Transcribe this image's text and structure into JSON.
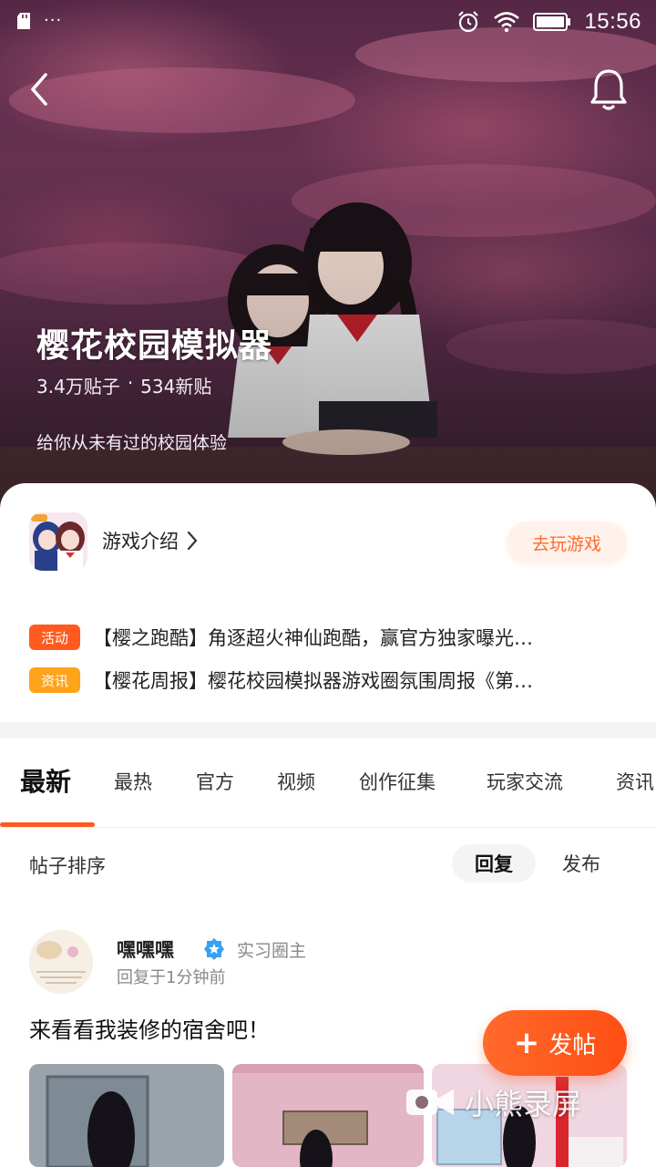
{
  "status_bar": {
    "time": "15:56",
    "icons": [
      "sd-card-icon",
      "more-dots-icon",
      "alarm-icon",
      "wifi-icon",
      "battery-icon"
    ]
  },
  "header": {
    "title": "樱花校园模拟器",
    "posts": "3.4万贴子",
    "separator": "·",
    "new_posts": "534新贴",
    "description": "给你从未有过的校园体验"
  },
  "game": {
    "intro_label": "游戏介绍",
    "play_label": "去玩游戏"
  },
  "notices": [
    {
      "tag": "活动",
      "tag_color": "#ff5a1f",
      "text": "【樱之跑酷】角逐超火神仙跑酷，赢官方独家曝光…"
    },
    {
      "tag": "资讯",
      "tag_color": "#ffa31a",
      "text": "【樱花周报】樱花校园模拟器游戏圈氛围周报《第…"
    }
  ],
  "tabs": [
    {
      "label": "最新",
      "active": true
    },
    {
      "label": "最热"
    },
    {
      "label": "官方"
    },
    {
      "label": "视频"
    },
    {
      "label": "创作征集"
    },
    {
      "label": "玩家交流"
    },
    {
      "label": "资讯"
    }
  ],
  "sort": {
    "label": "帖子排序",
    "options": [
      {
        "label": "回复",
        "active": true
      },
      {
        "label": "发布",
        "active": false
      }
    ]
  },
  "post": {
    "author": "嘿嘿嘿",
    "role": "实习圈主",
    "time": "回复于1分钟前",
    "title": "来看看我装修的宿舍吧！"
  },
  "fab": {
    "plus": "+",
    "label": "发帖"
  },
  "watermark": "小熊录屏",
  "colors": {
    "accent": "#ff5a1f",
    "activity_tag": "#ff5a1f",
    "news_tag": "#ffa31a"
  }
}
